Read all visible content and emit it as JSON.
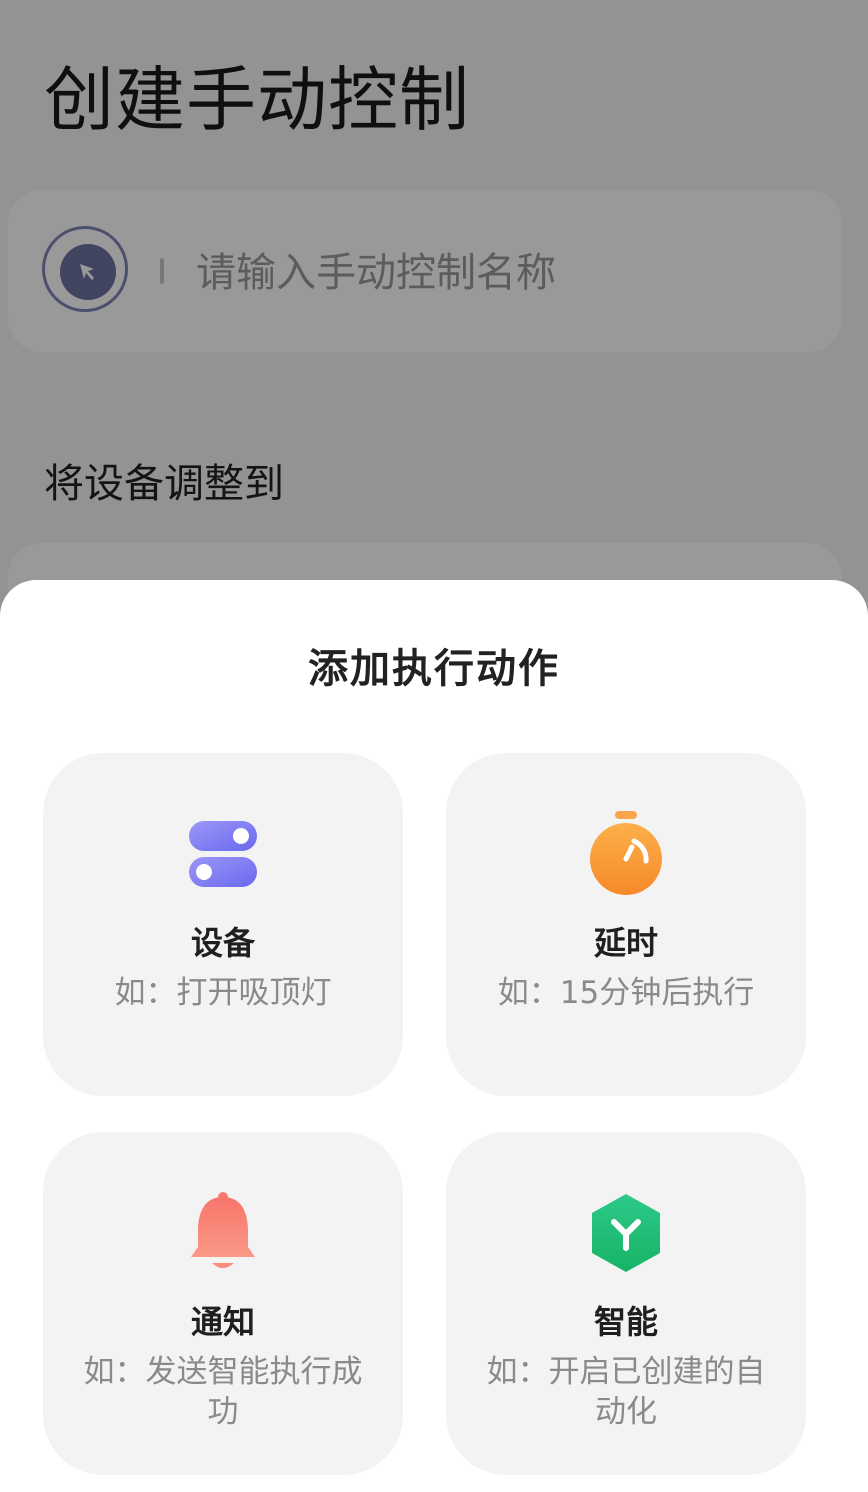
{
  "page": {
    "title": "创建手动控制",
    "name_input_placeholder": "请输入手动控制名称",
    "section_label": "将设备调整到"
  },
  "sheet": {
    "title": "添加执行动作",
    "options": [
      {
        "title": "设备",
        "desc": "如：打开吸顶灯",
        "icon": "toggle-switches-icon",
        "color": "#7b79f2"
      },
      {
        "title": "延时",
        "desc": "如：15分钟后执行",
        "icon": "stopwatch-icon",
        "color": "#fa9a30"
      },
      {
        "title": "通知",
        "desc": "如：发送智能执行成功",
        "icon": "bell-icon",
        "color": "#f77f72"
      },
      {
        "title": "智能",
        "desc": "如：开启已创建的自动化",
        "icon": "smart-hexagon-icon",
        "color": "#1fbe72"
      }
    ]
  }
}
